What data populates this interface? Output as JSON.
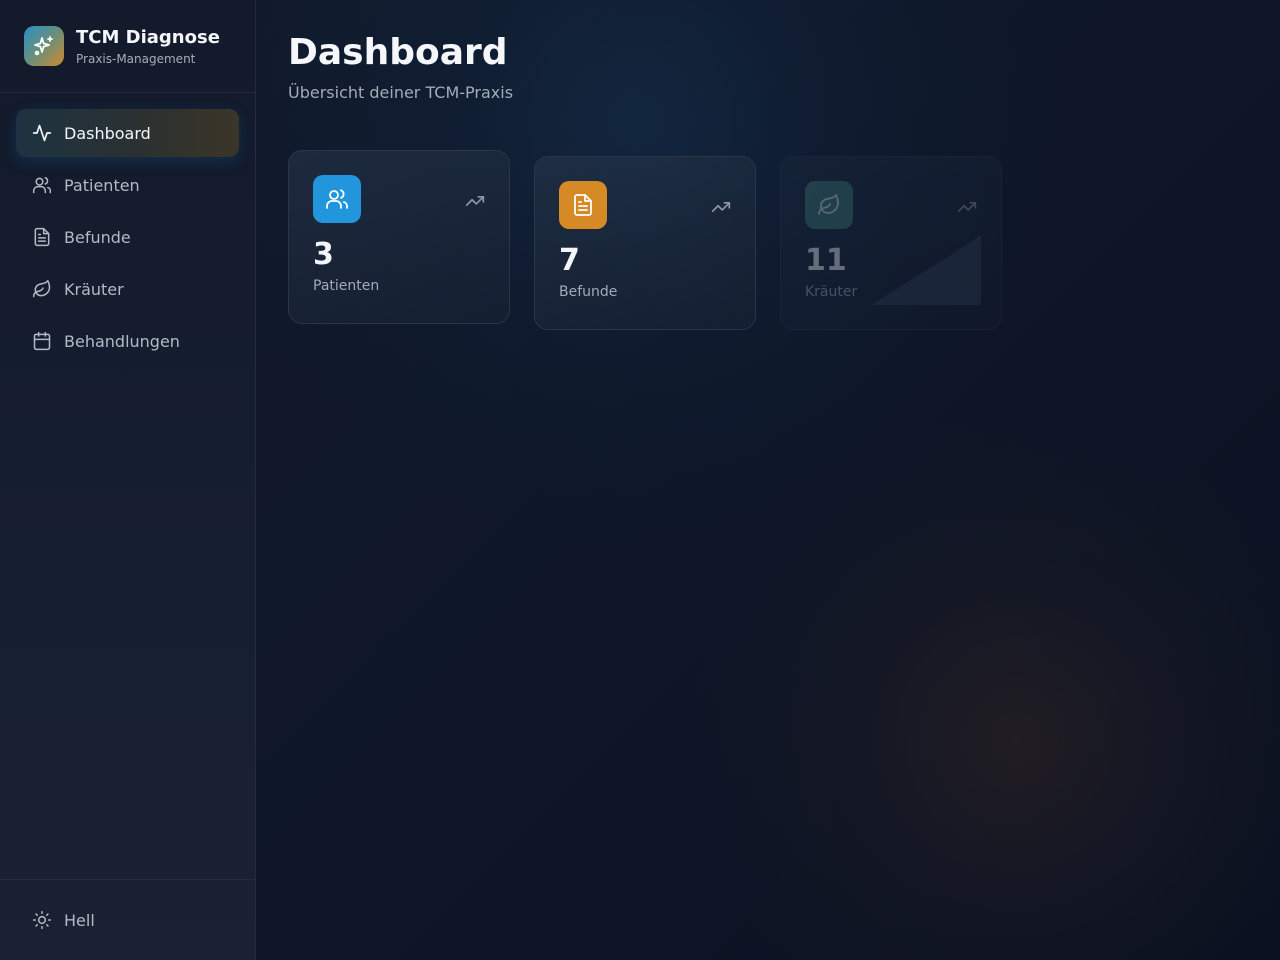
{
  "brand": {
    "title": "TCM Diagnose",
    "subtitle": "Praxis-Management",
    "icon": "sparkles-icon"
  },
  "nav": {
    "items": [
      {
        "label": "Dashboard",
        "icon": "activity-icon",
        "active": true
      },
      {
        "label": "Patienten",
        "icon": "users-icon",
        "active": false
      },
      {
        "label": "Befunde",
        "icon": "file-text-icon",
        "active": false
      },
      {
        "label": "Kräuter",
        "icon": "leaf-icon",
        "active": false
      },
      {
        "label": "Behandlungen",
        "icon": "calendar-icon",
        "active": false
      }
    ]
  },
  "footer": {
    "theme_label": "Hell",
    "theme_icon": "sun-icon"
  },
  "header": {
    "title": "Dashboard",
    "subtitle": "Übersicht deiner TCM-Praxis"
  },
  "stats": [
    {
      "value": "3",
      "label": "Patienten",
      "icon": "users-icon",
      "color": "#2196dc"
    },
    {
      "value": "7",
      "label": "Befunde",
      "icon": "file-text-icon",
      "color": "#d68a26"
    },
    {
      "value": "11",
      "label": "Kräuter",
      "icon": "leaf-icon",
      "color": "#3f7b76"
    }
  ],
  "colors": {
    "background": "#0d1424",
    "sidebar": "#141c2e",
    "accent_blue": "#2196dc",
    "accent_orange": "#d68a26"
  }
}
